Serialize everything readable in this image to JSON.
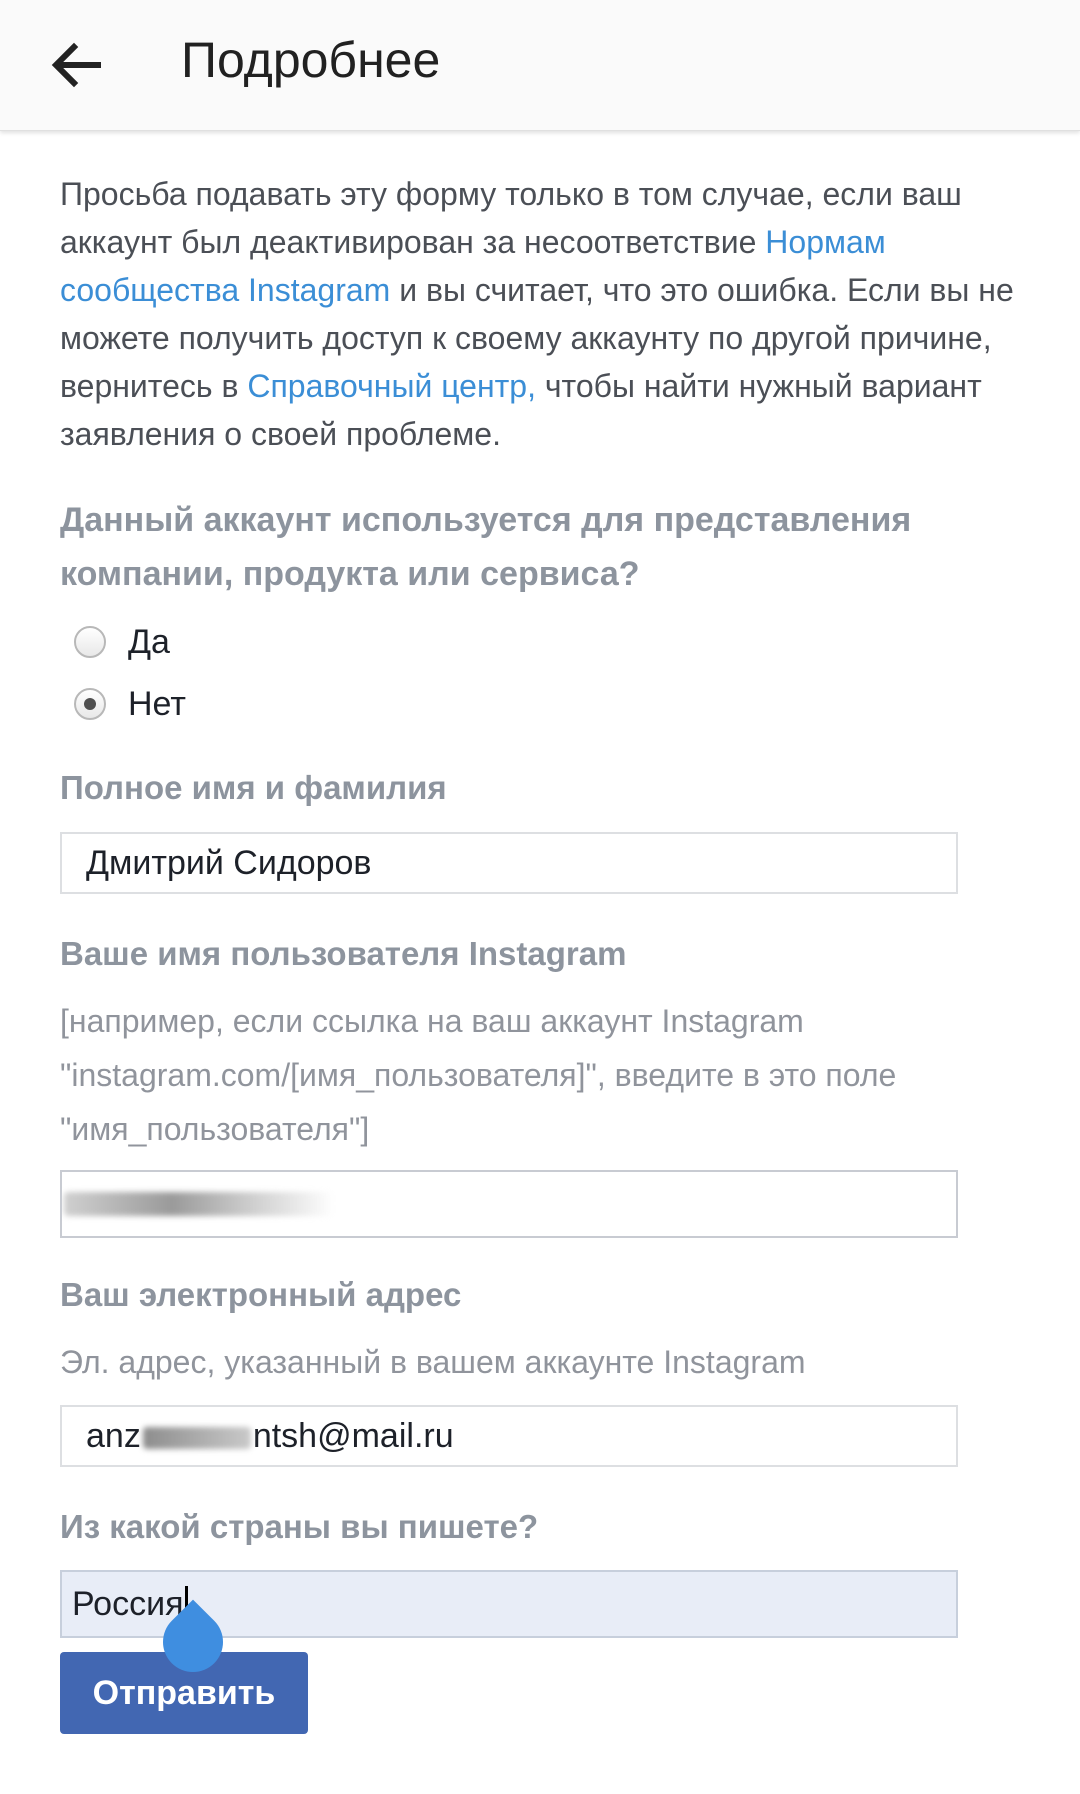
{
  "appbar": {
    "title": "Подробнее",
    "back_icon": "arrow-left-icon"
  },
  "intro": {
    "part1": "Просьба подавать эту форму только в том случае, если ваш аккаунт был деактивирован за несоответствие ",
    "link1": "Нормам сообщества Instagram",
    "part2": " и вы считает, что это ошибка. Если вы не можете получить доступ к своему аккаунту по другой причине, вернитесь в ",
    "link2": "Справочный центр,",
    "part3": " чтобы найти нужный вариант заявления о своей проблеме."
  },
  "business_question": {
    "label": "Данный аккаунт используется для представления компании, продукта или сервиса?",
    "options": [
      {
        "label": "Да",
        "checked": false
      },
      {
        "label": "Нет",
        "checked": true
      }
    ]
  },
  "full_name": {
    "label": "Полное имя и фамилия",
    "value": "Дмитрий Сидоров"
  },
  "username": {
    "label": "Ваше имя пользователя Instagram",
    "hint": "[например, если ссылка на ваш аккаунт Instagram \"instagram.com/[имя_пользователя]\", введите в это поле \"имя_пользователя\"]",
    "value": ""
  },
  "email": {
    "label": "Ваш электронный адрес",
    "hint": "Эл. адрес, указанный в вашем аккаунте Instagram",
    "value_prefix": "anz",
    "value_suffix": "ntsh@mail.ru"
  },
  "country": {
    "label": "Из какой страны вы пишете?",
    "value": "Россия"
  },
  "submit": {
    "label": "Отправить"
  },
  "colors": {
    "link": "#3b8ed6",
    "button": "#4267b2",
    "focused_input": "#e8edf7"
  }
}
